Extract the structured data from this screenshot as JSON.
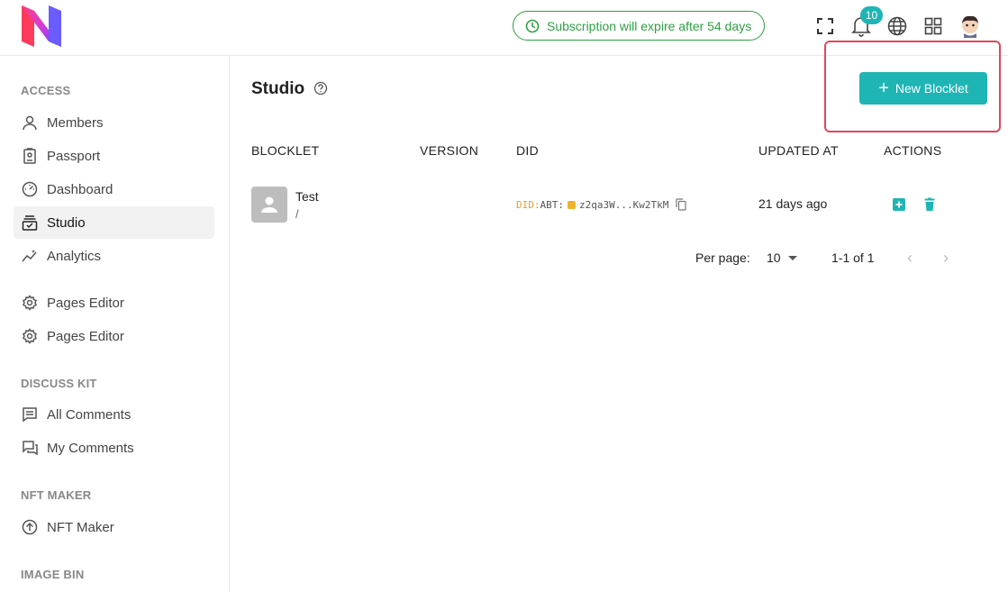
{
  "header": {
    "subscription_text": "Subscription will expire after 54 days",
    "notification_count": "10",
    "icons": [
      "fullscreen-icon",
      "bell-icon",
      "globe-icon",
      "apps-grid-icon",
      "user-avatar"
    ]
  },
  "sidebar": {
    "sections": [
      {
        "title": "ACCESS",
        "items": [
          {
            "label": "Members",
            "icon": "person-icon"
          },
          {
            "label": "Passport",
            "icon": "passport-icon"
          },
          {
            "label": "Dashboard",
            "icon": "gauge-icon"
          },
          {
            "label": "Studio",
            "icon": "studio-icon",
            "active": true
          },
          {
            "label": "Analytics",
            "icon": "analytics-icon"
          }
        ]
      },
      {
        "title": "",
        "items": [
          {
            "label": "Pages Editor",
            "icon": "gear-icon"
          },
          {
            "label": "Pages Editor",
            "icon": "gear-icon"
          }
        ]
      },
      {
        "title": "DISCUSS KIT",
        "items": [
          {
            "label": "All Comments",
            "icon": "comments-icon"
          },
          {
            "label": "My Comments",
            "icon": "my-comments-icon"
          }
        ]
      },
      {
        "title": "NFT MAKER",
        "items": [
          {
            "label": "NFT Maker",
            "icon": "upload-circle-icon"
          }
        ]
      },
      {
        "title": "IMAGE BIN",
        "items": []
      }
    ]
  },
  "main": {
    "title": "Studio",
    "new_button_label": "New Blocklet",
    "columns": [
      "BLOCKLET",
      "VERSION",
      "DID",
      "UPDATED AT",
      "ACTIONS"
    ],
    "rows": [
      {
        "name": "Test",
        "path": "/",
        "version": "",
        "did_prefix": "DID:",
        "did_type": "ABT:",
        "did_value": "z2qa3W...Kw2TkM",
        "updated": "21 days ago"
      }
    ],
    "pagination": {
      "per_page_label": "Per page:",
      "per_page_value": "10",
      "range": "1-1 of 1"
    }
  },
  "colors": {
    "accent": "#1fb5b5",
    "subscription_green": "#2ea043",
    "highlight_red": "#e0475a",
    "did_orange": "#e4a02b"
  }
}
